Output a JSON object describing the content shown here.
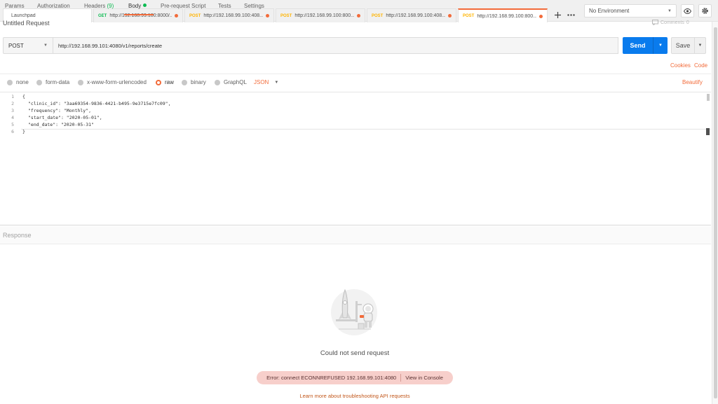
{
  "tabs": {
    "launchpad": "Launchpad",
    "items": [
      {
        "method": "GET",
        "url": "http://192.168.99.100:8000/..."
      },
      {
        "method": "POST",
        "url": "http://192.168.99.100:408..."
      },
      {
        "method": "POST",
        "url": "http://192.168.99.100:800..."
      },
      {
        "method": "POST",
        "url": "http://192.168.99.100:408..."
      },
      {
        "method": "POST",
        "url": "http://192.168.99.100:800..."
      }
    ],
    "add_icon": "plus-icon",
    "more_icon": "ellipsis-icon"
  },
  "environment": {
    "selected": "No Environment",
    "eye_icon": "eye-icon",
    "settings_icon": "gear-icon"
  },
  "request": {
    "title": "Untitled Request",
    "comments_label": "Comments",
    "comments_count": "0",
    "method": "POST",
    "url": "http://192.168.99.101:4080/v1/reports/create",
    "send_label": "Send",
    "save_label": "Save"
  },
  "subtabs": {
    "params": "Params",
    "authorization": "Authorization",
    "headers": "Headers",
    "headers_count": "(9)",
    "body": "Body",
    "prerequest": "Pre-request Script",
    "tests": "Tests",
    "settings": "Settings",
    "cookies": "Cookies",
    "code": "Code"
  },
  "body_options": {
    "none": "none",
    "form_data": "form-data",
    "urlencoded": "x-www-form-urlencoded",
    "raw": "raw",
    "binary": "binary",
    "graphql": "GraphQL",
    "format": "JSON",
    "beautify": "Beautify"
  },
  "editor": {
    "lines": [
      {
        "n": "1",
        "text": "{"
      },
      {
        "n": "2",
        "key": "\"clinic_id\"",
        "value": "\"3aa69354-9836-4421-b495-9e3715e7fc09\","
      },
      {
        "n": "3",
        "key": "\"frequency\"",
        "value": "\"Monthly\","
      },
      {
        "n": "4",
        "key": "\"start_date\"",
        "value": "\"2020-05-01\","
      },
      {
        "n": "5",
        "key": "\"end_date\"",
        "value": "\"2020-05-31\""
      },
      {
        "n": "6",
        "text": "}"
      }
    ]
  },
  "response": {
    "title": "Response",
    "message": "Could not send request",
    "error": "Error: connect ECONNREFUSED 192.168.99.101:4080",
    "view_console": "View in Console",
    "learn_more": "Learn more about troubleshooting API requests"
  },
  "colors": {
    "accent": "#f26b3a",
    "send_blue": "#097bed",
    "get_green": "#0cbb52",
    "post_yellow": "#ffb400",
    "error_bg": "#f7cfcb"
  }
}
